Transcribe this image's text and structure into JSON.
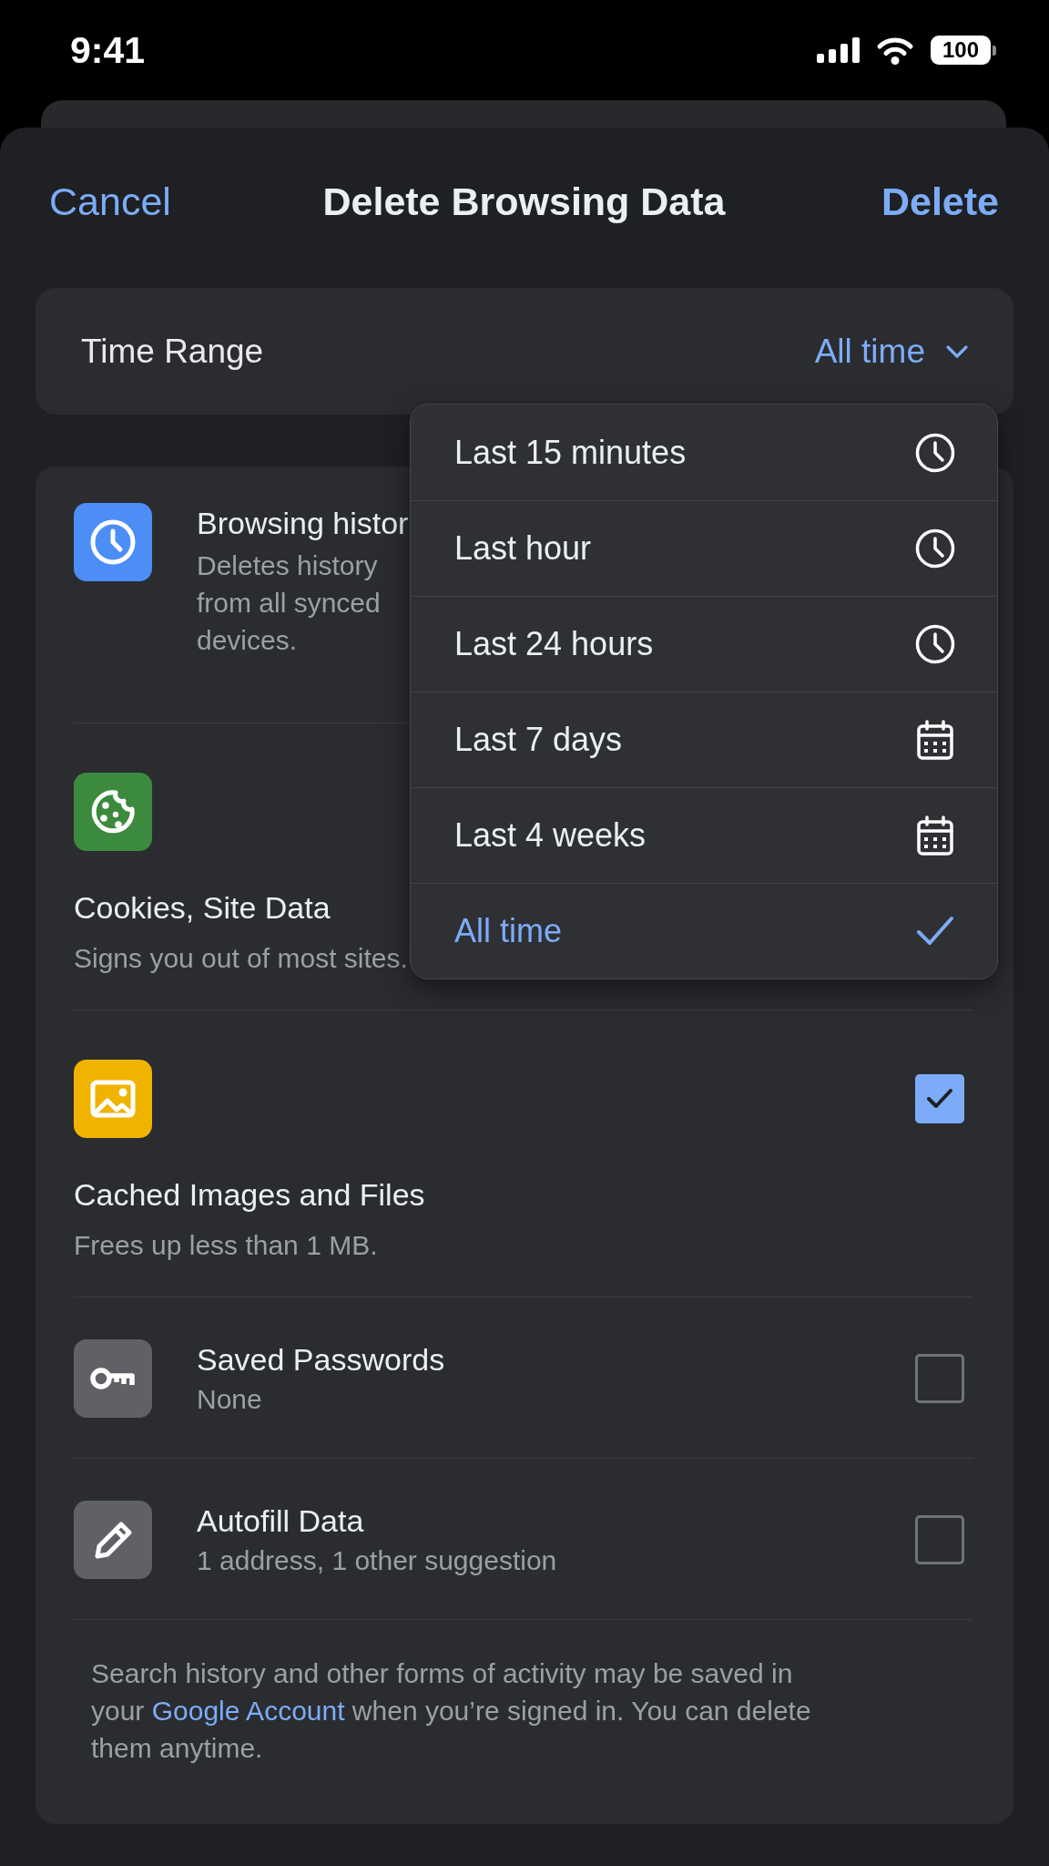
{
  "status_bar": {
    "time": "9:41",
    "battery": "100"
  },
  "header": {
    "cancel": "Cancel",
    "title": "Delete Browsing Data",
    "delete": "Delete"
  },
  "time_range": {
    "label": "Time Range",
    "value": "All time",
    "expanded": true
  },
  "time_menu": [
    {
      "label": "Last 15 minutes",
      "kind": "time",
      "selected": false
    },
    {
      "label": "Last hour",
      "kind": "time",
      "selected": false
    },
    {
      "label": "Last 24 hours",
      "kind": "time",
      "selected": false
    },
    {
      "label": "Last 7 days",
      "kind": "date",
      "selected": false
    },
    {
      "label": "Last 4 weeks",
      "kind": "date",
      "selected": false
    },
    {
      "label": "All time",
      "selected": true
    }
  ],
  "data_types": [
    {
      "kind": "narrow",
      "title": "Browsing histor",
      "subtitle": "Deletes history from all synced devices."
    },
    {
      "kind": "stacked",
      "title": "Cookies, Site Data",
      "subtitle": "Signs you out of most sites."
    },
    {
      "kind": "stacked",
      "title": "Cached Images and Files",
      "subtitle": "Frees up less than 1 MB.",
      "checked": true
    },
    {
      "kind": "inline",
      "title": "Saved Passwords",
      "subtitle": "None",
      "checked": false
    },
    {
      "kind": "inline",
      "title": "Autofill Data",
      "subtitle": "1 address, 1 other suggestion",
      "checked": false
    }
  ],
  "footer": {
    "before": "Search history and other forms of activity may be saved in your ",
    "link": "Google Account",
    "after": " when you’re signed in. You can delete them anytime."
  }
}
